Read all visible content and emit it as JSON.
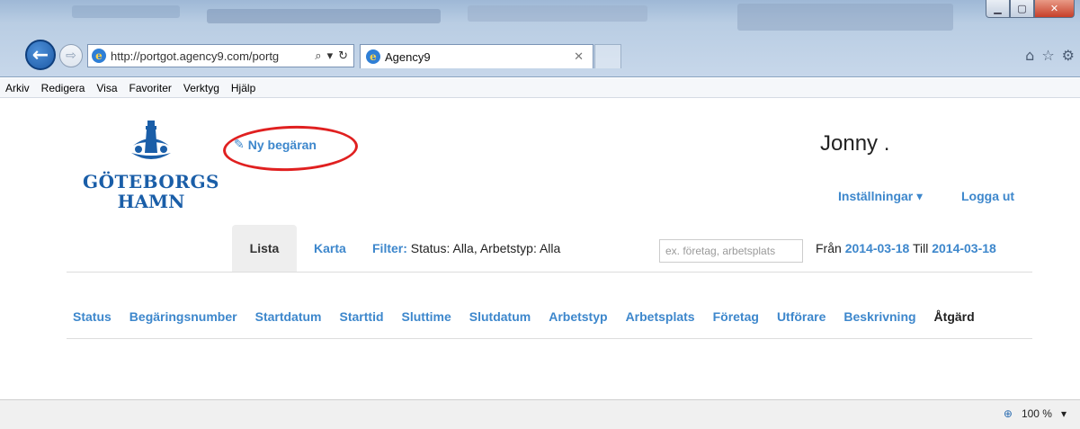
{
  "browser": {
    "address_url": "http://portgot.agency9.com/portg",
    "tab_title": "Agency9",
    "window_controls": [
      "minimize",
      "maximize",
      "close"
    ]
  },
  "menu": {
    "items": [
      "Arkiv",
      "Redigera",
      "Visa",
      "Favoriter",
      "Verktyg",
      "Hjälp"
    ]
  },
  "page": {
    "logo": {
      "line1": "GÖTEBORGS",
      "line2": "HAMN"
    },
    "ny_begaran": "Ny begäran",
    "username": "Jonny .",
    "settings": "Inställningar",
    "logout": "Logga ut",
    "tabs": {
      "lista": "Lista",
      "karta": "Karta"
    },
    "filter": {
      "label": "Filter:",
      "text": "Status: Alla, Arbetstyp: Alla"
    },
    "search_placeholder": "ex. företag, arbetsplats",
    "date_range": {
      "from_label": "Från",
      "from": "2014-03-18",
      "to_label": "Till",
      "to": "2014-03-18"
    },
    "columns": [
      "Status",
      "Begäringsnumber",
      "Startdatum",
      "Starttid",
      "Sluttime",
      "Slutdatum",
      "Arbetstyp",
      "Arbetsplats",
      "Företag",
      "Utförare",
      "Beskrivning",
      "Åtgärd"
    ]
  },
  "statusbar": {
    "zoom": "100 %"
  },
  "colors": {
    "link": "#3d87cc",
    "highlight": "#e02020",
    "logo": "#1a5ea8"
  }
}
